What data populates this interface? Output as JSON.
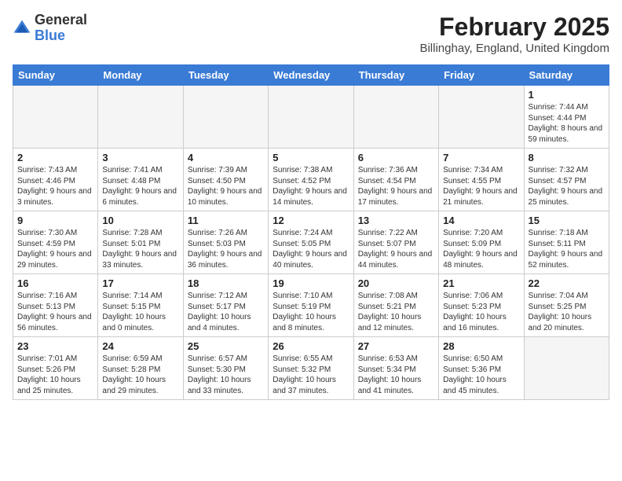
{
  "header": {
    "logo_general": "General",
    "logo_blue": "Blue",
    "month_title": "February 2025",
    "location": "Billinghay, England, United Kingdom"
  },
  "weekdays": [
    "Sunday",
    "Monday",
    "Tuesday",
    "Wednesday",
    "Thursday",
    "Friday",
    "Saturday"
  ],
  "weeks": [
    [
      {
        "day": "",
        "info": ""
      },
      {
        "day": "",
        "info": ""
      },
      {
        "day": "",
        "info": ""
      },
      {
        "day": "",
        "info": ""
      },
      {
        "day": "",
        "info": ""
      },
      {
        "day": "",
        "info": ""
      },
      {
        "day": "1",
        "info": "Sunrise: 7:44 AM\nSunset: 4:44 PM\nDaylight: 8 hours and 59 minutes."
      }
    ],
    [
      {
        "day": "2",
        "info": "Sunrise: 7:43 AM\nSunset: 4:46 PM\nDaylight: 9 hours and 3 minutes."
      },
      {
        "day": "3",
        "info": "Sunrise: 7:41 AM\nSunset: 4:48 PM\nDaylight: 9 hours and 6 minutes."
      },
      {
        "day": "4",
        "info": "Sunrise: 7:39 AM\nSunset: 4:50 PM\nDaylight: 9 hours and 10 minutes."
      },
      {
        "day": "5",
        "info": "Sunrise: 7:38 AM\nSunset: 4:52 PM\nDaylight: 9 hours and 14 minutes."
      },
      {
        "day": "6",
        "info": "Sunrise: 7:36 AM\nSunset: 4:54 PM\nDaylight: 9 hours and 17 minutes."
      },
      {
        "day": "7",
        "info": "Sunrise: 7:34 AM\nSunset: 4:55 PM\nDaylight: 9 hours and 21 minutes."
      },
      {
        "day": "8",
        "info": "Sunrise: 7:32 AM\nSunset: 4:57 PM\nDaylight: 9 hours and 25 minutes."
      }
    ],
    [
      {
        "day": "9",
        "info": "Sunrise: 7:30 AM\nSunset: 4:59 PM\nDaylight: 9 hours and 29 minutes."
      },
      {
        "day": "10",
        "info": "Sunrise: 7:28 AM\nSunset: 5:01 PM\nDaylight: 9 hours and 33 minutes."
      },
      {
        "day": "11",
        "info": "Sunrise: 7:26 AM\nSunset: 5:03 PM\nDaylight: 9 hours and 36 minutes."
      },
      {
        "day": "12",
        "info": "Sunrise: 7:24 AM\nSunset: 5:05 PM\nDaylight: 9 hours and 40 minutes."
      },
      {
        "day": "13",
        "info": "Sunrise: 7:22 AM\nSunset: 5:07 PM\nDaylight: 9 hours and 44 minutes."
      },
      {
        "day": "14",
        "info": "Sunrise: 7:20 AM\nSunset: 5:09 PM\nDaylight: 9 hours and 48 minutes."
      },
      {
        "day": "15",
        "info": "Sunrise: 7:18 AM\nSunset: 5:11 PM\nDaylight: 9 hours and 52 minutes."
      }
    ],
    [
      {
        "day": "16",
        "info": "Sunrise: 7:16 AM\nSunset: 5:13 PM\nDaylight: 9 hours and 56 minutes."
      },
      {
        "day": "17",
        "info": "Sunrise: 7:14 AM\nSunset: 5:15 PM\nDaylight: 10 hours and 0 minutes."
      },
      {
        "day": "18",
        "info": "Sunrise: 7:12 AM\nSunset: 5:17 PM\nDaylight: 10 hours and 4 minutes."
      },
      {
        "day": "19",
        "info": "Sunrise: 7:10 AM\nSunset: 5:19 PM\nDaylight: 10 hours and 8 minutes."
      },
      {
        "day": "20",
        "info": "Sunrise: 7:08 AM\nSunset: 5:21 PM\nDaylight: 10 hours and 12 minutes."
      },
      {
        "day": "21",
        "info": "Sunrise: 7:06 AM\nSunset: 5:23 PM\nDaylight: 10 hours and 16 minutes."
      },
      {
        "day": "22",
        "info": "Sunrise: 7:04 AM\nSunset: 5:25 PM\nDaylight: 10 hours and 20 minutes."
      }
    ],
    [
      {
        "day": "23",
        "info": "Sunrise: 7:01 AM\nSunset: 5:26 PM\nDaylight: 10 hours and 25 minutes."
      },
      {
        "day": "24",
        "info": "Sunrise: 6:59 AM\nSunset: 5:28 PM\nDaylight: 10 hours and 29 minutes."
      },
      {
        "day": "25",
        "info": "Sunrise: 6:57 AM\nSunset: 5:30 PM\nDaylight: 10 hours and 33 minutes."
      },
      {
        "day": "26",
        "info": "Sunrise: 6:55 AM\nSunset: 5:32 PM\nDaylight: 10 hours and 37 minutes."
      },
      {
        "day": "27",
        "info": "Sunrise: 6:53 AM\nSunset: 5:34 PM\nDaylight: 10 hours and 41 minutes."
      },
      {
        "day": "28",
        "info": "Sunrise: 6:50 AM\nSunset: 5:36 PM\nDaylight: 10 hours and 45 minutes."
      },
      {
        "day": "",
        "info": ""
      }
    ]
  ]
}
